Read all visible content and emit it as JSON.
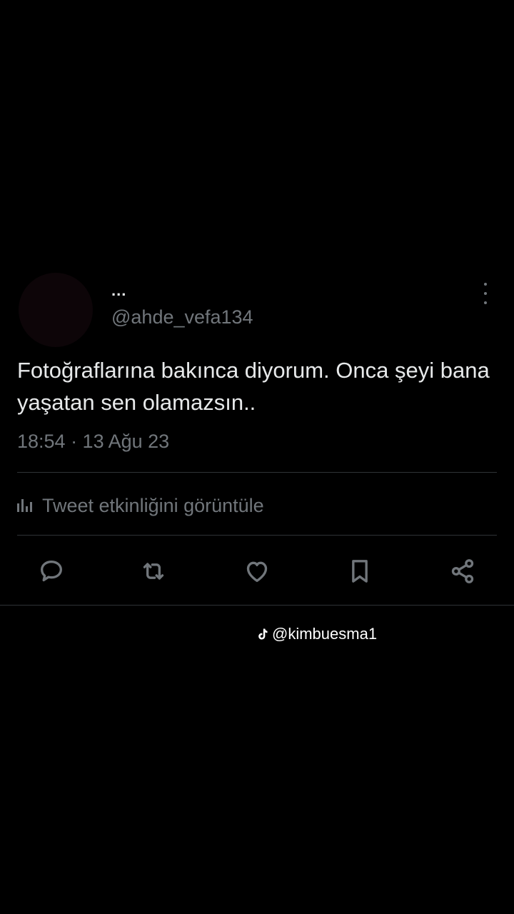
{
  "tweet": {
    "display_name": "...",
    "handle": "@ahde_vefa134",
    "text": "Fotoğraflarına bakınca diyorum. Onca şeyi bana yaşatan sen olamazsın..",
    "time": "18:54 · 13 Ağu 23",
    "activity_label": "Tweet etkinliğini görüntüle"
  },
  "actions": [
    {
      "icon": "reply-icon"
    },
    {
      "icon": "retweet-icon"
    },
    {
      "icon": "like-icon"
    },
    {
      "icon": "bookmark-icon"
    },
    {
      "icon": "share-icon"
    }
  ],
  "watermark": {
    "icon": "tiktok-icon",
    "text": "@kimbuesma1"
  },
  "colors": {
    "background": "#000000",
    "primary_text": "#e7e9ea",
    "secondary_text": "#71767b",
    "divider": "#2f3336"
  }
}
